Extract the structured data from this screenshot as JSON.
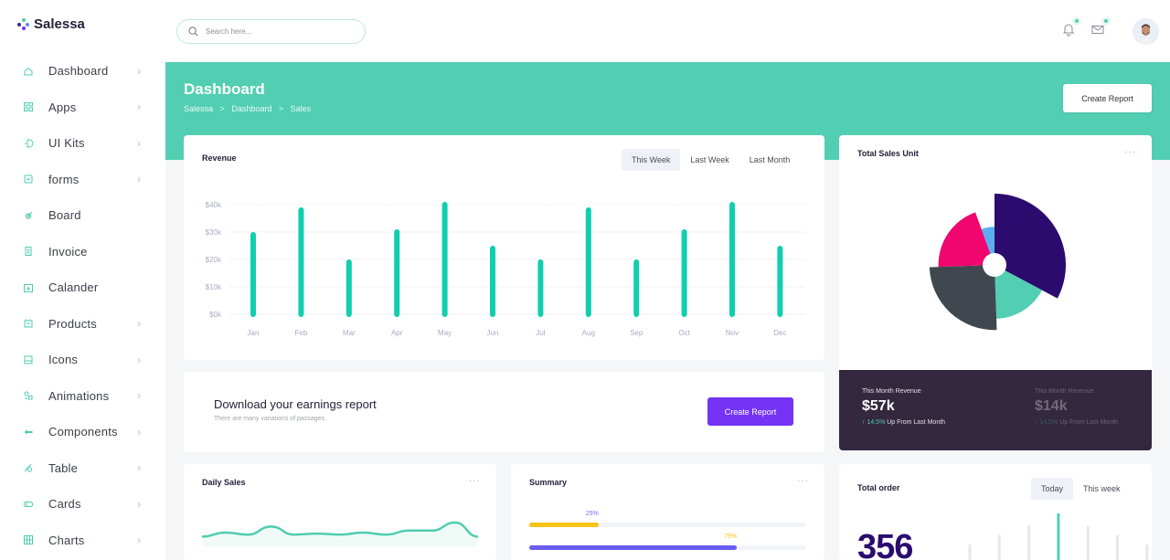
{
  "brand": {
    "name": "Salessa",
    "accent": "#52ceb2",
    "logo_colors": [
      "#4fcdb1",
      "#5b8af7",
      "#7433f5",
      "#3b2a8c"
    ]
  },
  "search": {
    "placeholder": "Search here..."
  },
  "topbar": {
    "icons": [
      {
        "name": "bell-icon",
        "has_badge": true
      },
      {
        "name": "mail-icon",
        "has_badge": true
      }
    ],
    "avatar": "user-avatar"
  },
  "sidebar": {
    "items": [
      {
        "label": "Dashboard",
        "icon": "home-icon",
        "has_children": true
      },
      {
        "label": "Apps",
        "icon": "apps-grid-icon",
        "has_children": true
      },
      {
        "label": "UI Kits",
        "icon": "ui-kits-icon",
        "has_children": true
      },
      {
        "label": "forms",
        "icon": "forms-icon",
        "has_children": true
      },
      {
        "label": "Board",
        "icon": "board-icon",
        "has_children": false
      },
      {
        "label": "Invoice",
        "icon": "invoice-icon",
        "has_children": false
      },
      {
        "label": "Calander",
        "icon": "calendar-icon",
        "has_children": false
      },
      {
        "label": "Products",
        "icon": "products-icon",
        "has_children": true
      },
      {
        "label": "Icons",
        "icon": "icons-icon",
        "has_children": true
      },
      {
        "label": "Animations",
        "icon": "animations-icon",
        "has_children": true
      },
      {
        "label": "Components",
        "icon": "components-icon",
        "has_children": true
      },
      {
        "label": "Table",
        "icon": "table-icon",
        "has_children": true
      },
      {
        "label": "Cards",
        "icon": "cards-icon",
        "has_children": true
      },
      {
        "label": "Charts",
        "icon": "charts-icon",
        "has_children": true
      }
    ],
    "chevron": "›"
  },
  "header": {
    "title": "Dashboard",
    "breadcrumb": [
      "Salessa",
      ">",
      "Dashboard",
      ">",
      "Sales"
    ],
    "create_report_label": "Create Report"
  },
  "revenue": {
    "title": "Revenue",
    "tabs": [
      {
        "label": "This Week",
        "active": true
      },
      {
        "label": "Last Week",
        "active": false
      },
      {
        "label": "Last Month",
        "active": false
      }
    ]
  },
  "download": {
    "title": "Download your earnings report",
    "subtitle": "There are many variations of passages.",
    "button_label": "Create Report"
  },
  "total_sales_unit": {
    "title": "Total Sales Unit",
    "more": "···"
  },
  "month_revenue": [
    {
      "label": "This Month Revenue",
      "value": "$57k",
      "change": "↑ 14.5%",
      "change_text": "Up From Last Month",
      "faded": false
    },
    {
      "label": "This Month Revenue",
      "value": "$14k",
      "change": "↑ 14.5%",
      "change_text": "Up From Last Month",
      "faded": true
    }
  ],
  "daily_sales": {
    "title": "Daily Sales",
    "more": "···"
  },
  "summary": {
    "title": "Summary",
    "more": "···",
    "bars": [
      {
        "label": "25%",
        "value": 0.25,
        "color": "#f5c518",
        "label_color": "#7b6cf0"
      },
      {
        "label": "75%",
        "value": 0.75,
        "color": "#6a5cf0",
        "label_color": "#f5c518"
      }
    ]
  },
  "total_order": {
    "title": "Total order",
    "value": "356",
    "tabs": [
      {
        "label": "Today",
        "active": true
      },
      {
        "label": "This week",
        "active": false
      }
    ]
  },
  "chart_data": [
    {
      "type": "bar",
      "title": "Revenue",
      "categories": [
        "Jan",
        "Feb",
        "Mar",
        "Apr",
        "May",
        "Jun",
        "Jul",
        "Aug",
        "Sep",
        "Oct",
        "Nov",
        "Dec"
      ],
      "values": [
        29,
        38,
        19,
        30,
        40,
        24,
        19,
        38,
        19,
        30,
        40,
        24
      ],
      "yticks": [
        "$0k",
        "$10k",
        "$20k",
        "$30k",
        "$40k"
      ],
      "ylim": [
        0,
        40
      ],
      "unit": "$k",
      "color": "#0fcfae",
      "grid": true
    },
    {
      "type": "pie",
      "title": "Total Sales Unit",
      "variant": "polar-area",
      "series": [
        {
          "name": "Purple",
          "value": 42,
          "color": "#2c0b6e"
        },
        {
          "name": "Teal",
          "value": 24,
          "color": "#52ceb2"
        },
        {
          "name": "Dark Gray",
          "value": 35,
          "color": "#41474f"
        },
        {
          "name": "Pink",
          "value": 26,
          "color": "#f0066e"
        },
        {
          "name": "Blue",
          "value": 12,
          "color": "#5aaef0"
        }
      ]
    },
    {
      "type": "line",
      "title": "Daily Sales",
      "values": [
        3,
        5,
        4,
        8,
        4,
        4.5,
        4,
        5,
        4,
        6,
        6,
        10,
        3
      ],
      "color": "#4fcdb1"
    },
    {
      "type": "bar",
      "title": "Total order",
      "values": [
        3,
        5,
        7,
        9,
        7,
        5,
        3
      ],
      "highlight_index": 3,
      "color": "#e6e8ec",
      "highlight_color": "#52ceb2"
    }
  ]
}
